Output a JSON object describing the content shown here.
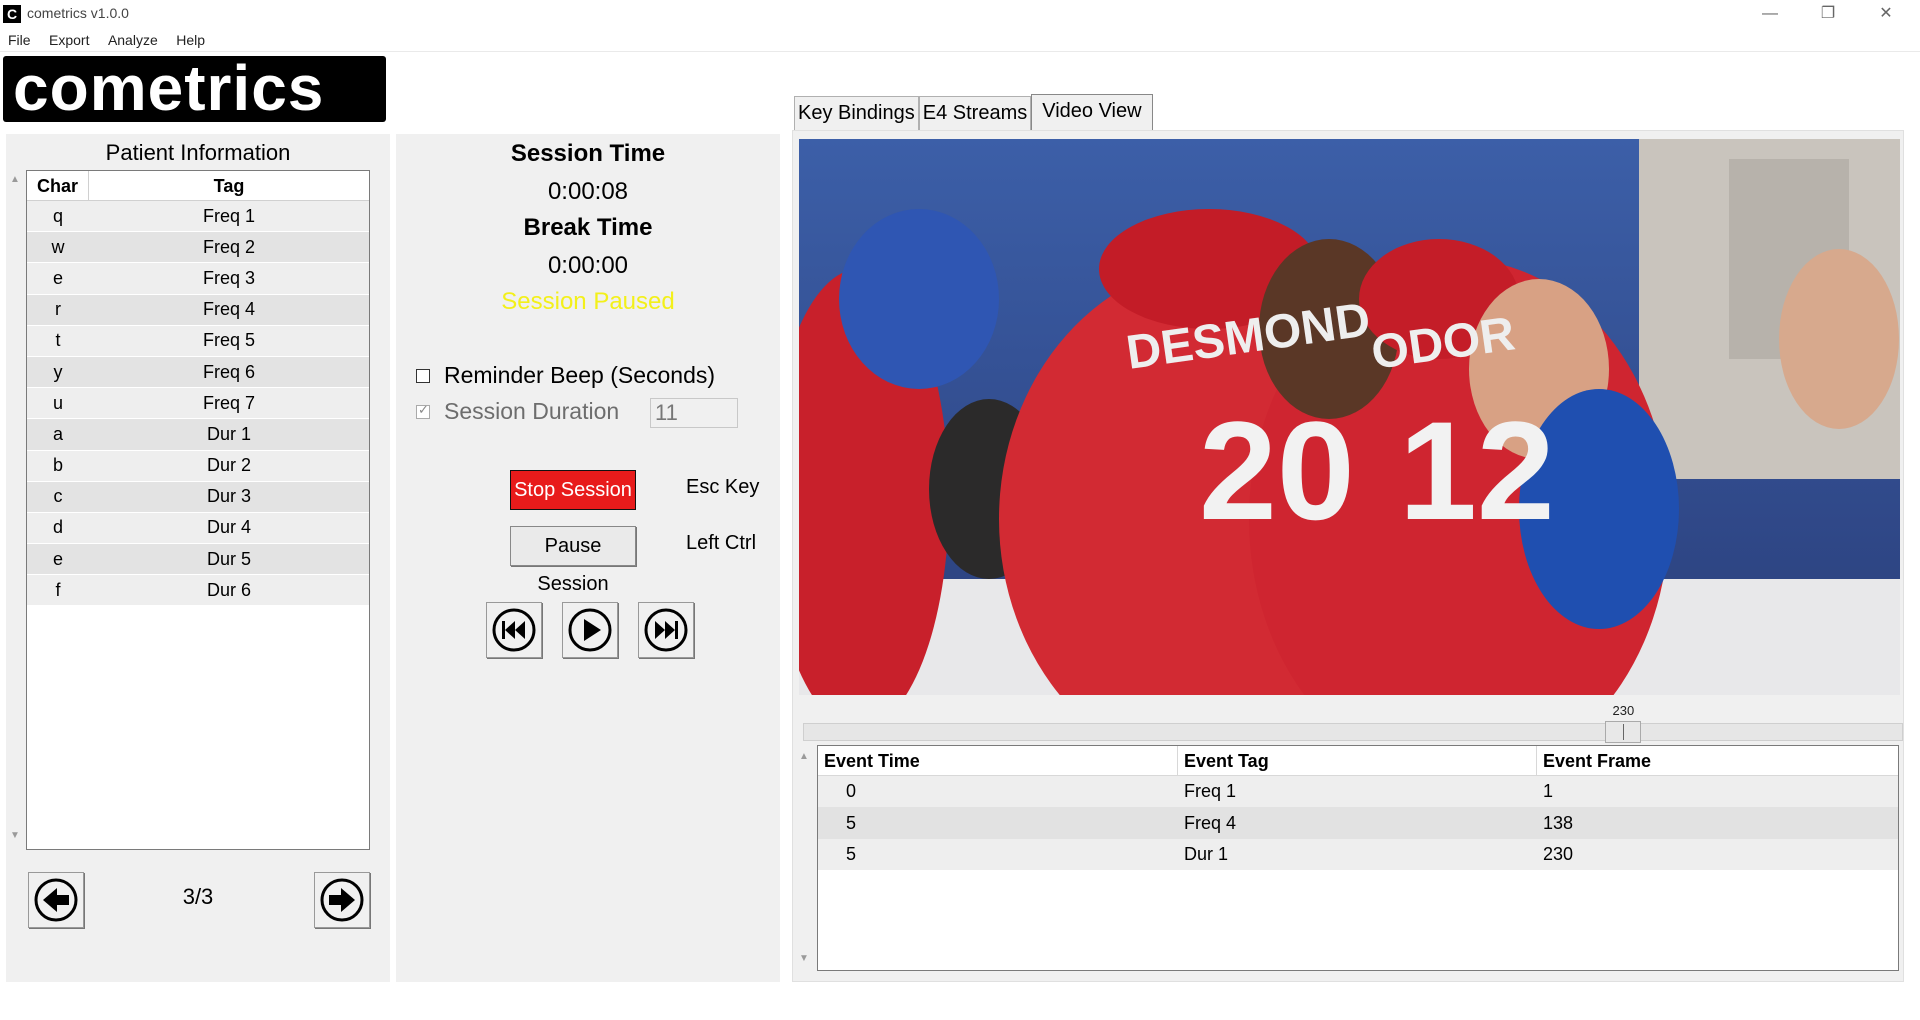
{
  "window": {
    "title": "cometrics v1.0.0",
    "app_icon_letter": "C",
    "minimize": "—",
    "restore": "❐",
    "close": "✕"
  },
  "menu": [
    "File",
    "Export",
    "Analyze",
    "Help"
  ],
  "logo_text": "cometrics",
  "left_panel": {
    "title": "Patient Information",
    "table": {
      "headers": [
        "Char",
        "Tag"
      ],
      "rows": [
        [
          "q",
          "Freq 1"
        ],
        [
          "w",
          "Freq 2"
        ],
        [
          "e",
          "Freq 3"
        ],
        [
          "r",
          "Freq 4"
        ],
        [
          "t",
          "Freq 5"
        ],
        [
          "y",
          "Freq 6"
        ],
        [
          "u",
          "Freq 7"
        ],
        [
          "a",
          "Dur 1"
        ],
        [
          "b",
          "Dur 2"
        ],
        [
          "c",
          "Dur 3"
        ],
        [
          "d",
          "Dur 4"
        ],
        [
          "e",
          "Dur 5"
        ],
        [
          "f",
          "Dur 6"
        ]
      ]
    },
    "page_indicator": "3/3"
  },
  "session": {
    "session_time_label": "Session Time",
    "session_time": "0:00:08",
    "break_time_label": "Break Time",
    "break_time": "0:00:00",
    "status": "Session Paused",
    "status_color": "#f3f01a",
    "reminder_beep_label": "Reminder Beep (Seconds)",
    "reminder_beep_checked": false,
    "session_duration_label": "Session Duration",
    "session_duration_checked": true,
    "session_duration_value": "11",
    "stop_button": "Stop Session",
    "stop_key": "Esc Key",
    "pause_button": "Pause Session",
    "pause_key": "Left Ctrl"
  },
  "tabs": [
    "Key Bindings",
    "E4 Streams",
    "Video View"
  ],
  "active_tab": "Video View",
  "video": {
    "jersey_names": [
      "DESMOND",
      "ODOR"
    ],
    "jersey_numbers": [
      "20",
      "12"
    ],
    "slider_value": "230",
    "slider_fraction": 0.745
  },
  "events": {
    "headers": [
      "Event Time",
      "Event Tag",
      "Event Frame"
    ],
    "rows": [
      [
        "0",
        "Freq 1",
        "1"
      ],
      [
        "5",
        "Freq 4",
        "138"
      ],
      [
        "5",
        "Dur 1",
        "230"
      ]
    ]
  }
}
